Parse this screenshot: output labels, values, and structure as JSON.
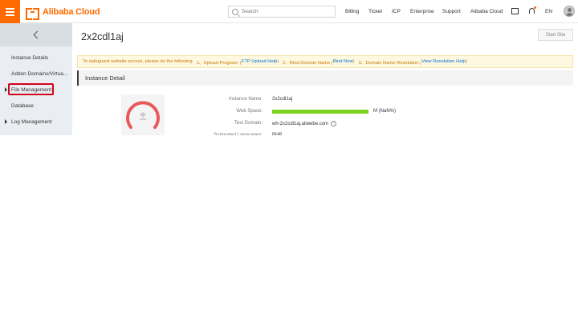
{
  "header": {
    "logo_text": "Alibaba Cloud",
    "search_placeholder": "Search",
    "nav": [
      "Billing",
      "Ticket",
      "ICP",
      "Enterprise",
      "Support",
      "Alibaba Cloud"
    ],
    "lang": "EN",
    "accent": "#ff6a00"
  },
  "sidebar": {
    "items": [
      {
        "label": "Instance Details"
      },
      {
        "label": "Addon Domains/Virtua..."
      },
      {
        "label": "File Management"
      },
      {
        "label": "Database"
      },
      {
        "label": "Log Management"
      }
    ]
  },
  "main": {
    "title": "2x2cdl1aj",
    "start_button": "Start Site",
    "notice": {
      "prefix": "To safeguard website access, please do the following",
      "step1": "1、Upload Program: (",
      "step1_link": "FTP Upload Help",
      "step2": "2、Bind Domain Name (",
      "step2_link": "Bind Now",
      "step3": "3、Domain Name Resolution (",
      "step3_link": "View Resolution Help",
      "close": ")"
    },
    "section_title": "Instance Detail",
    "details": {
      "name_label": "Instance Name:",
      "name_value": "2x2cdl1aj",
      "space_label": "Web Space:",
      "space_value": "M (NaN%)",
      "domain_label": "Test Domain:",
      "domain_value": "wh-2x2cdl1aj.aliwebe.com",
      "lang_label": "Supported Languages:",
      "lang_value": "PHP"
    },
    "gauge_color": "#e8595d",
    "bar_color": "#7ed321"
  }
}
